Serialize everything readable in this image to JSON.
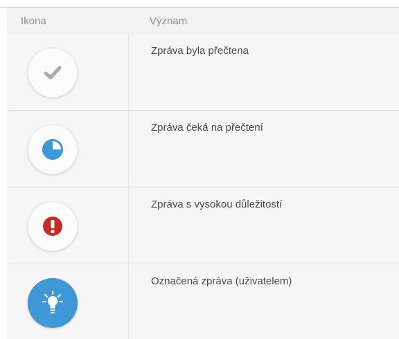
{
  "table": {
    "header": {
      "icon_col": "Ikona",
      "meaning_col": "Význam"
    },
    "rows": [
      {
        "icon": "checkmark-icon",
        "label": "Zpráva byla přečtena"
      },
      {
        "icon": "pie-clock-icon",
        "label": "Zpráva čeká na přečtení"
      },
      {
        "icon": "exclamation-icon",
        "label": "Zpráva s vysokou důležitostí"
      },
      {
        "icon": "lightbulb-icon",
        "label": "Označená zpráva (uživatelem)"
      }
    ]
  },
  "colors": {
    "checkmark": "#a9a9a9",
    "pending": "#3d98d8",
    "important": "#c62a2a",
    "flagged": "#3f97d6"
  }
}
